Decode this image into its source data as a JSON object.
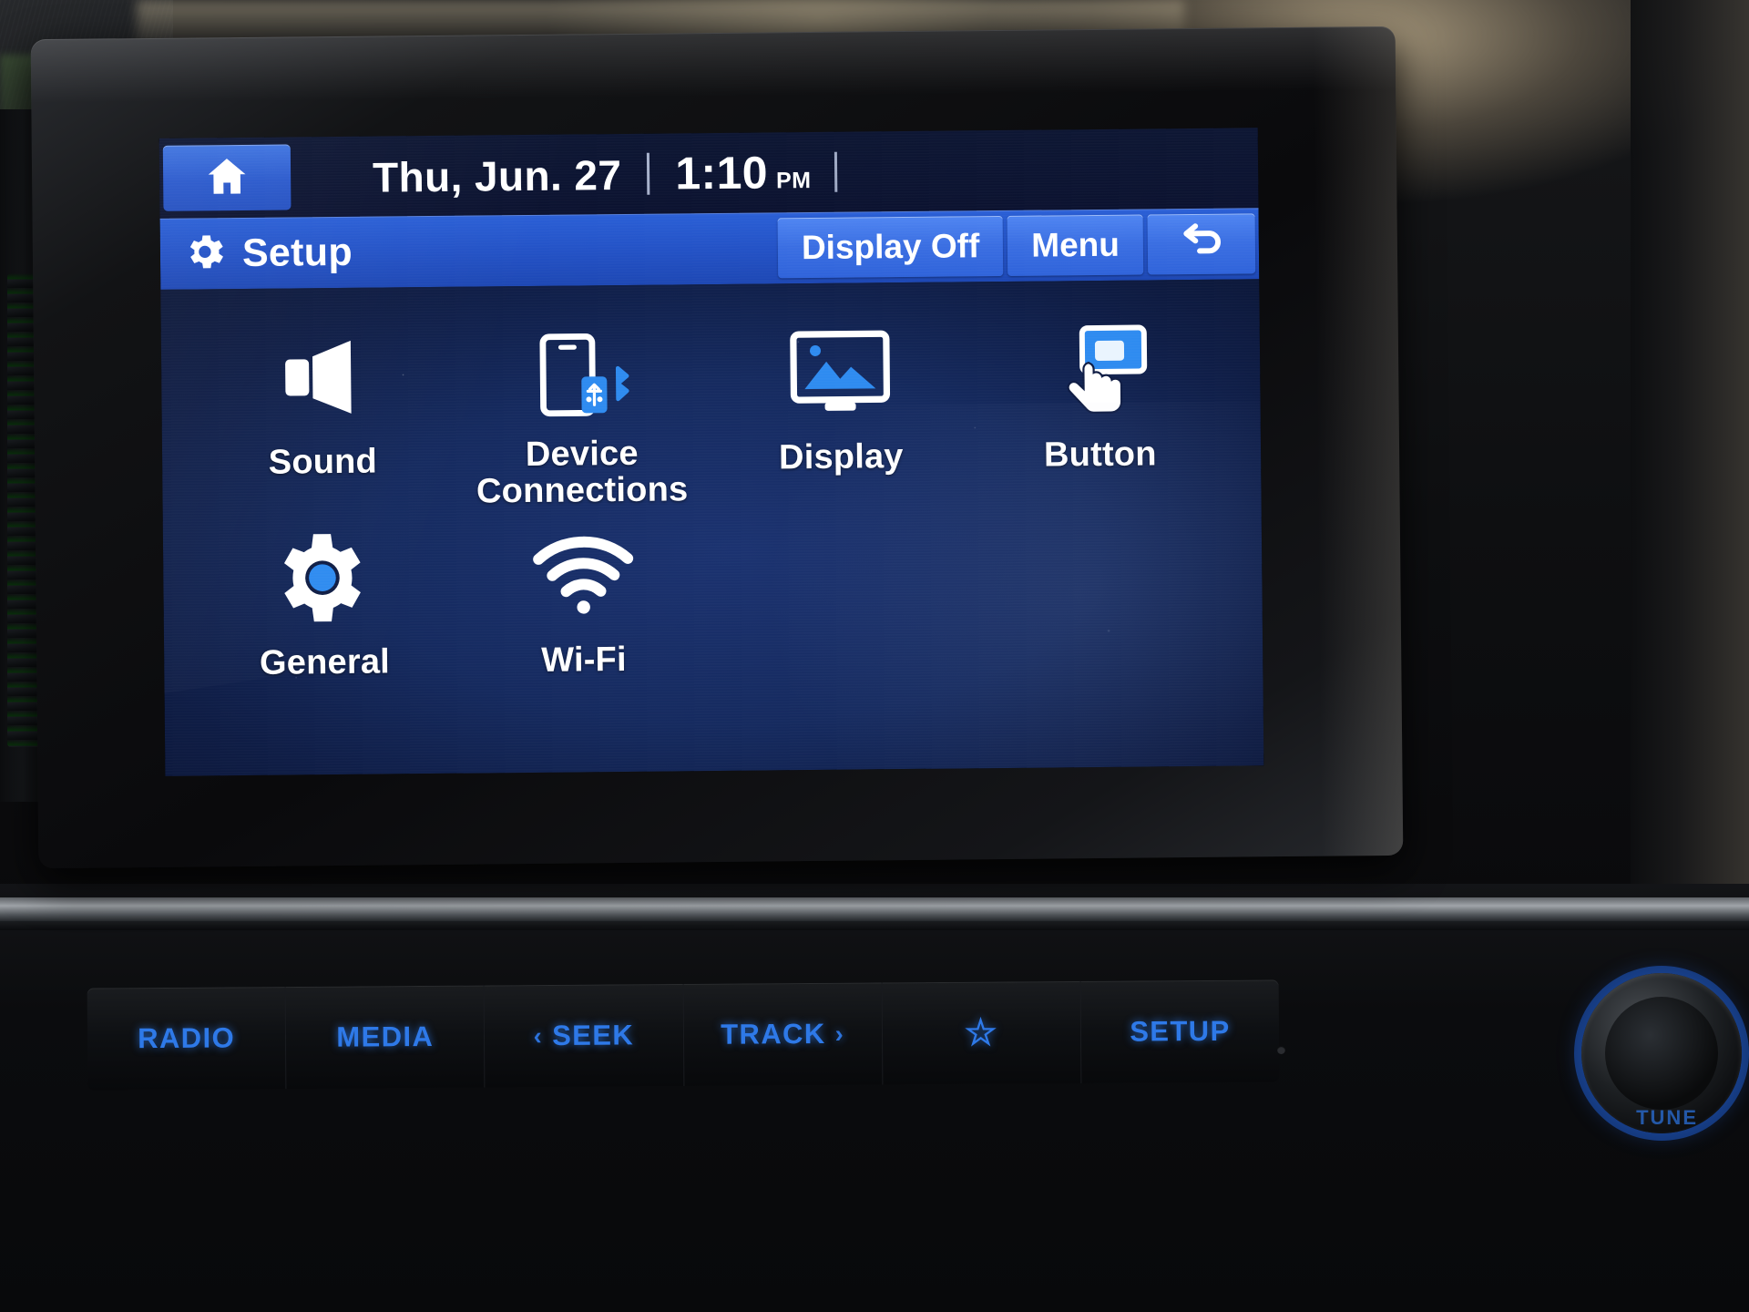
{
  "status_bar": {
    "home_icon": "home-icon",
    "date": "Thu, Jun. 27",
    "time": "1:10",
    "ampm": "PM"
  },
  "title_bar": {
    "icon": "gear-icon",
    "title": "Setup",
    "display_off_label": "Display Off",
    "menu_label": "Menu",
    "back_icon": "back-arrow-icon"
  },
  "menu_grid": {
    "items": [
      {
        "label": "Sound",
        "icon": "speaker-icon",
        "icon_color": "#ffffff"
      },
      {
        "label": "Device\nConnections",
        "icon": "device-connections-icon",
        "icon_color": "#ffffff"
      },
      {
        "label": "Display",
        "icon": "monitor-icon",
        "icon_color": "#ffffff"
      },
      {
        "label": "Button",
        "icon": "touch-button-icon",
        "icon_color": "#ffffff"
      },
      {
        "label": "General",
        "icon": "gear-icon",
        "icon_color": "#ffffff"
      },
      {
        "label": "Wi-Fi",
        "icon": "wifi-icon",
        "icon_color": "#ffffff"
      }
    ],
    "labels": {
      "sound": "Sound",
      "device_connections_line1": "Device",
      "device_connections_line2": "Connections",
      "display": "Display",
      "button": "Button",
      "general": "General",
      "wifi": "Wi-Fi"
    }
  },
  "hardware_buttons": {
    "radio": "RADIO",
    "media": "MEDIA",
    "seek": "SEEK",
    "seek_chevron": "‹",
    "track": "TRACK",
    "track_chevron": "›",
    "favorite_icon": "star-icon",
    "favorite": "☆",
    "setup": "SETUP",
    "tune_knob_label": "TUNE"
  },
  "colors": {
    "screen_bg": "#0e1c44",
    "title_bar_blue": "#2352c6",
    "button_blue": "#3a6ee2",
    "accent_icon_blue": "#2e8bf0",
    "hard_key_blue": "#2e79e8",
    "text_white": "#ffffff"
  }
}
